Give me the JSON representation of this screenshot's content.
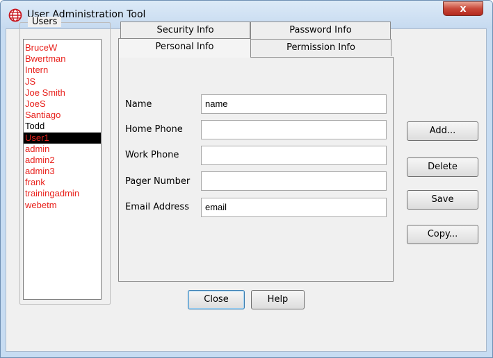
{
  "window": {
    "title": "User Administration Tool",
    "close_glyph": "x"
  },
  "users": {
    "legend": "Users",
    "items": [
      {
        "name": "BruceW",
        "color": "#e8211c"
      },
      {
        "name": "Bwertman",
        "color": "#e8211c"
      },
      {
        "name": "Intern",
        "color": "#e8211c"
      },
      {
        "name": "JS",
        "color": "#e8211c"
      },
      {
        "name": "Joe Smith",
        "color": "#e8211c"
      },
      {
        "name": "JoeS",
        "color": "#e8211c"
      },
      {
        "name": "Santiago",
        "color": "#e8211c"
      },
      {
        "name": "Todd",
        "color": "#000000"
      },
      {
        "name": "User1",
        "color": "#e8211c",
        "selected": true
      },
      {
        "name": "admin",
        "color": "#e8211c"
      },
      {
        "name": "admin2",
        "color": "#e8211c"
      },
      {
        "name": "admin3",
        "color": "#e8211c"
      },
      {
        "name": "frank",
        "color": "#e8211c"
      },
      {
        "name": "trainingadmin",
        "color": "#e8211c"
      },
      {
        "name": "webetm",
        "color": "#e8211c"
      }
    ]
  },
  "tabs": {
    "security": "Security Info",
    "password": "Password Info",
    "personal": "Personal Info",
    "permission": "Permission Info",
    "active": "Personal Info"
  },
  "form": {
    "name_label": "Name",
    "name_value": "name",
    "home_phone_label": "Home Phone",
    "home_phone_value": "",
    "work_phone_label": "Work Phone",
    "work_phone_value": "",
    "pager_label": "Pager Number",
    "pager_value": "",
    "email_label": "Email Address",
    "email_value": "email"
  },
  "actions": {
    "add": "Add...",
    "delete": "Delete",
    "save": "Save",
    "copy": "Copy..."
  },
  "footer": {
    "close": "Close",
    "help": "Help"
  },
  "colors": {
    "user_red": "#e8211c",
    "selection": "#000000",
    "titlebar": "#c6daf0"
  }
}
